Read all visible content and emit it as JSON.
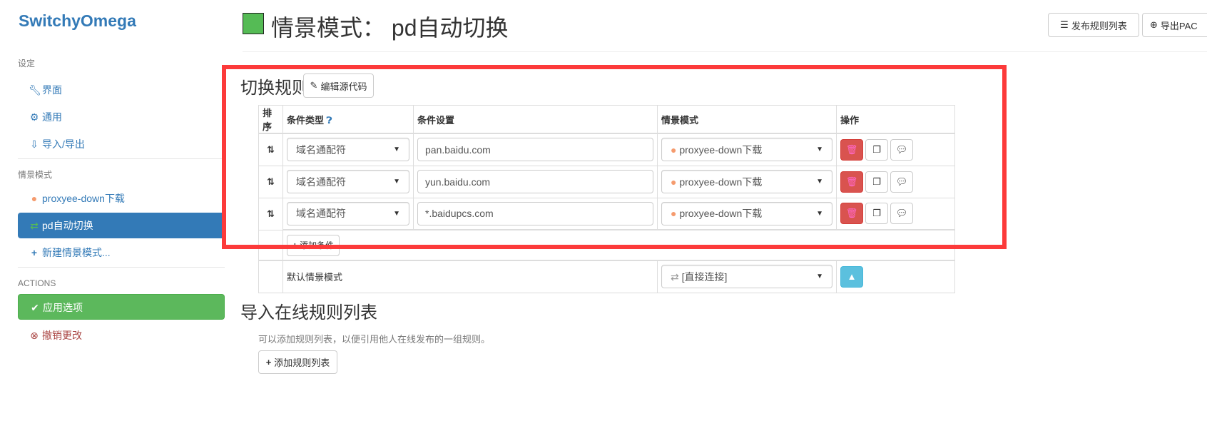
{
  "sidebar": {
    "brand": "SwitchyOmega",
    "settings_header": "设定",
    "settings_items": [
      {
        "label": "界面",
        "icon": "wrench-icon"
      },
      {
        "label": "通用",
        "icon": "gear-icon"
      },
      {
        "label": "导入/导出",
        "icon": "import-export-icon"
      }
    ],
    "profiles_header": "情景模式",
    "profiles": [
      {
        "label": "proxyee-down下载",
        "icon": "globe-icon",
        "color": "#f59b6e"
      },
      {
        "label": "pd自动切换",
        "icon": "retweet-icon",
        "active": true,
        "color": "#55bb55"
      }
    ],
    "new_profile": "新建情景模式...",
    "actions_header": "ACTIONS",
    "apply": "应用选项",
    "revert": "撤销更改"
  },
  "header": {
    "title": "情景模式： pd自动切换",
    "profile_color": "#55bb55",
    "publish_button": "发布规则列表",
    "export_pac_button": "导出PAC"
  },
  "rules": {
    "heading": "切换规则",
    "edit_source": "编辑源代码",
    "columns": [
      "排序",
      "条件类型",
      "条件设置",
      "情景模式",
      "操作"
    ],
    "rows": [
      {
        "type": "域名通配符",
        "pattern": "pan.baidu.com",
        "profile": "proxyee-down下载"
      },
      {
        "type": "域名通配符",
        "pattern": "yun.baidu.com",
        "profile": "proxyee-down下载"
      },
      {
        "type": "域名通配符",
        "pattern": "*.baidupcs.com",
        "profile": "proxyee-down下载"
      }
    ],
    "add_condition": "添加条件",
    "default_label": "默认情景模式",
    "default_profile": "[直接连接]"
  },
  "online": {
    "heading": "导入在线规则列表",
    "description": "可以添加规则列表，以便引用他人在线发布的一组规则。",
    "add_button": "添加规则列表"
  },
  "colors": {
    "primary": "#337ab7",
    "success": "#5cb85c",
    "danger": "#d9534f",
    "info": "#5bc0de",
    "highlight": "#fc3a3a"
  }
}
